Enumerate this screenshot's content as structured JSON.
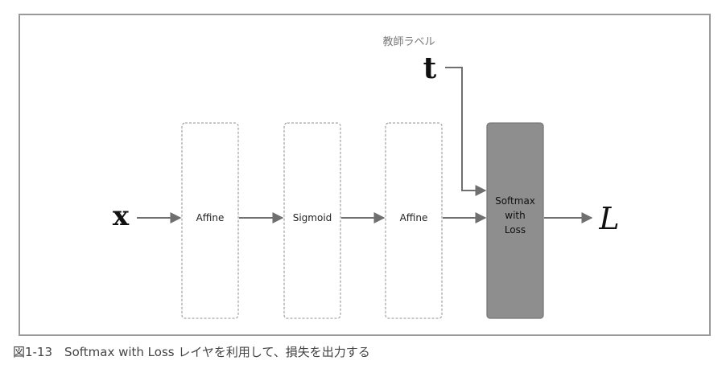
{
  "diagram": {
    "input_label": "x",
    "teacher_label": "教師ラベル",
    "target_label": "t",
    "output_label": "L",
    "layers": [
      {
        "label": "Affine"
      },
      {
        "label": "Sigmoid"
      },
      {
        "label": "Affine"
      }
    ],
    "loss_layer": {
      "lines": [
        "Softmax",
        "with",
        "Loss"
      ]
    }
  },
  "caption": "図1-13　Softmax with Loss レイヤを利用して、損失を出力する",
  "colors": {
    "frame": "#9a9a9a",
    "layer_border": "#a8a8a8",
    "loss_fill": "#8e8e8e",
    "loss_border": "#777777",
    "arrow": "#6f6f6f",
    "teacher_text": "#7a7a7a",
    "caption_text": "#444444"
  }
}
